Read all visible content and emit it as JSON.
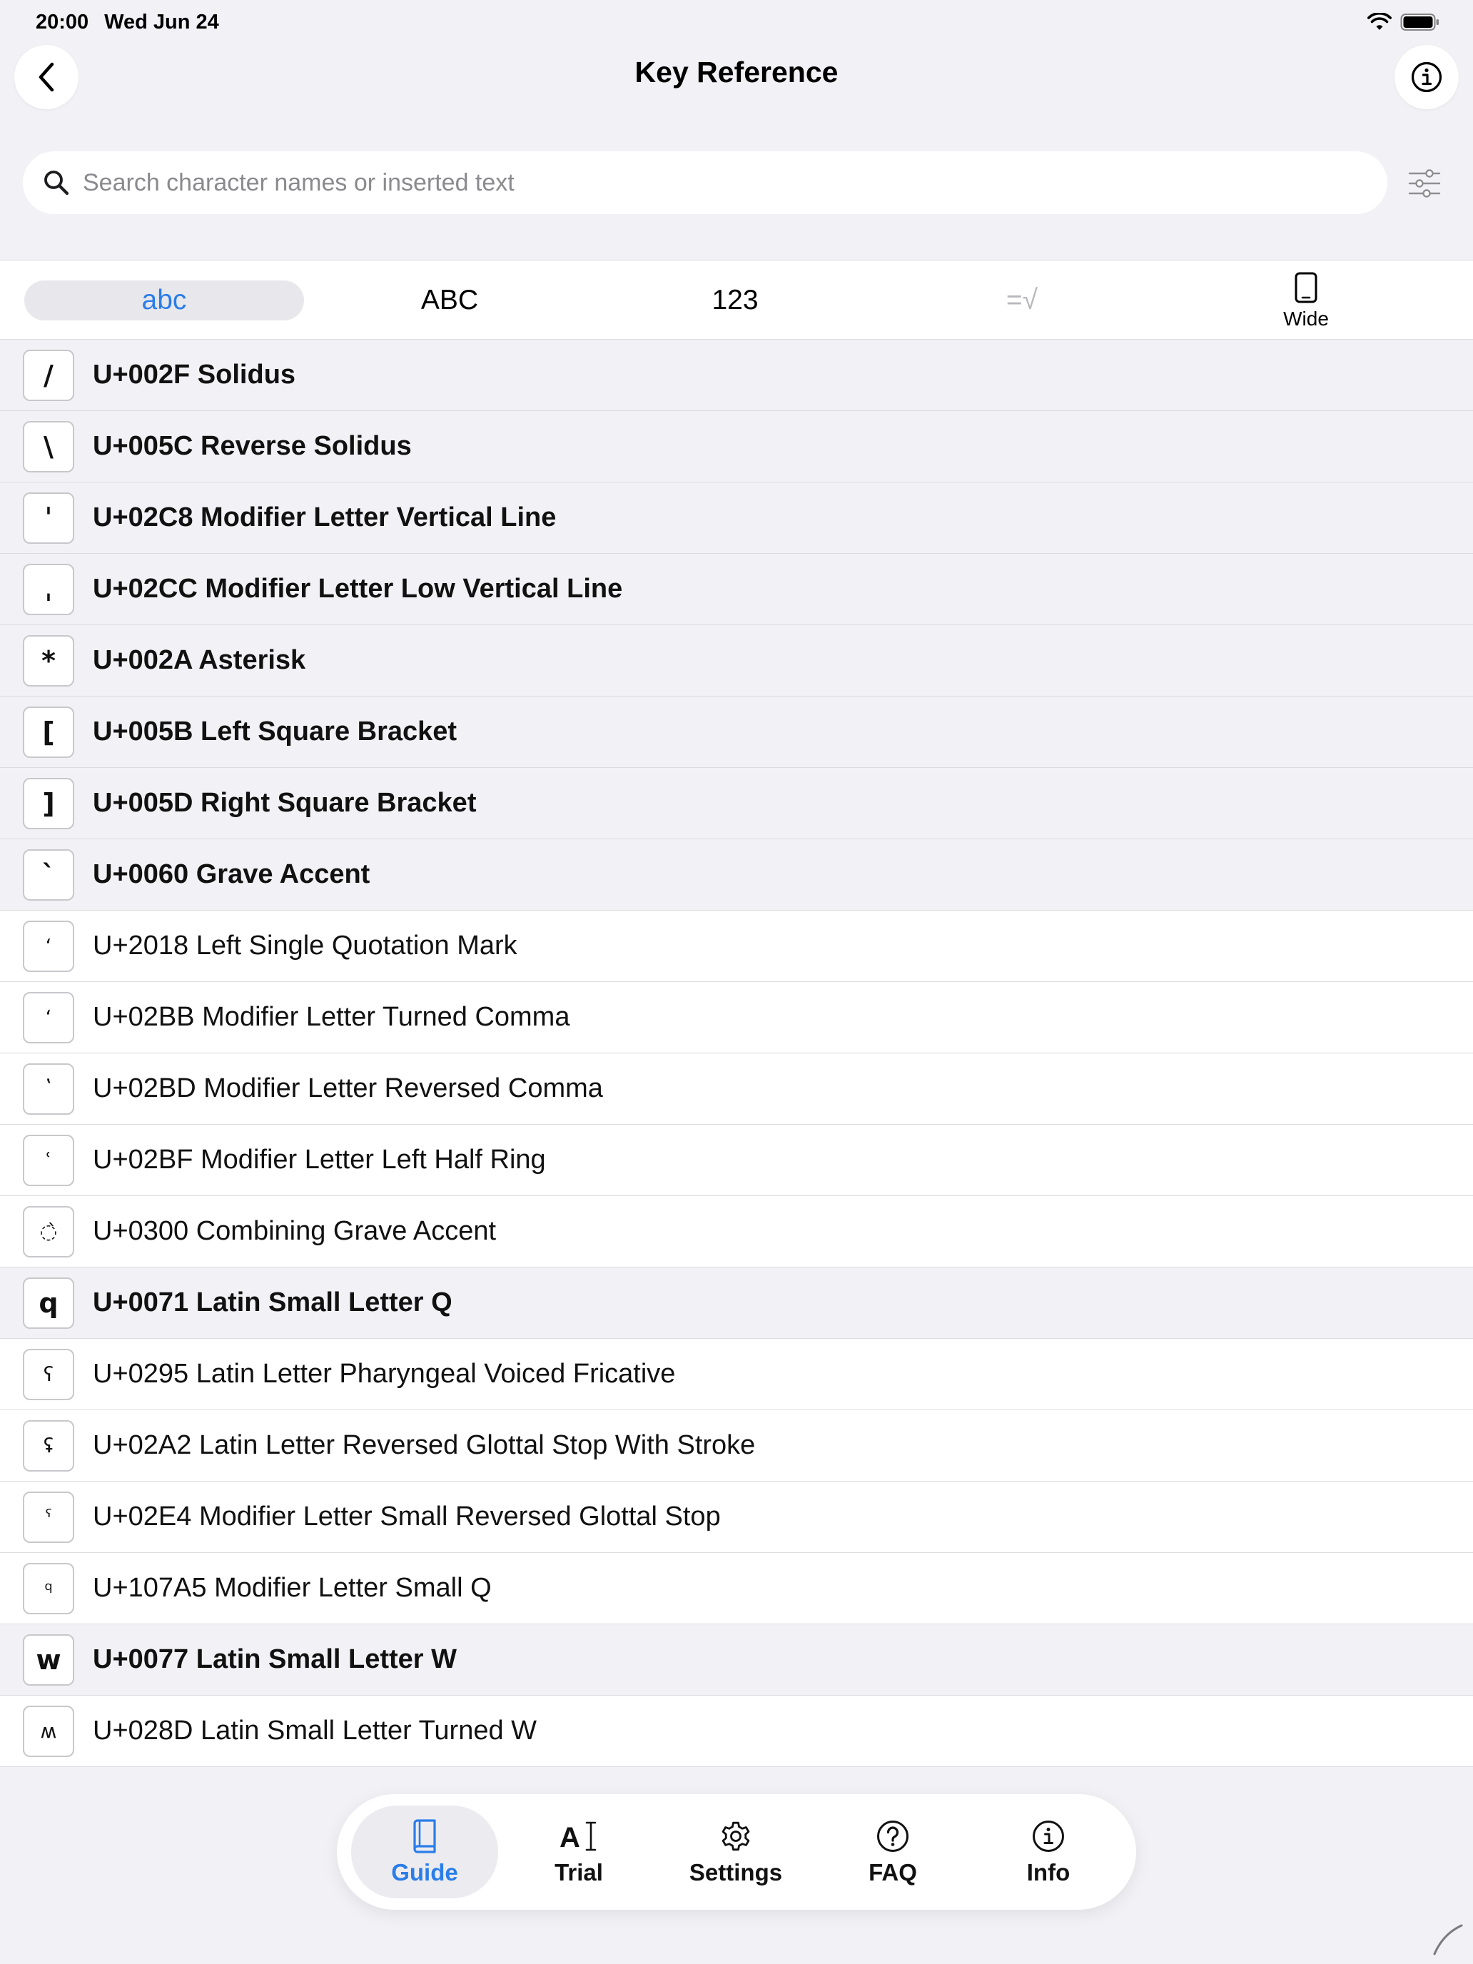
{
  "status_bar": {
    "time": "20:00",
    "date": "Wed Jun 24"
  },
  "header": {
    "title": "Key Reference"
  },
  "search": {
    "placeholder": "Search character names or inserted text"
  },
  "segments": [
    {
      "label": "abc",
      "state": "active"
    },
    {
      "label": "ABC",
      "state": "normal"
    },
    {
      "label": "123",
      "state": "normal"
    },
    {
      "label": "=√",
      "state": "disabled"
    },
    {
      "label": "Wide",
      "icon": "tablet-icon"
    }
  ],
  "rows": [
    {
      "glyph": "/",
      "label": "U+002F Solidus",
      "bold": true
    },
    {
      "glyph": "\\",
      "label": "U+005C Reverse Solidus",
      "bold": true
    },
    {
      "glyph": "ˈ",
      "label": "U+02C8 Modifier Letter Vertical Line",
      "bold": true
    },
    {
      "glyph": "ˌ",
      "label": "U+02CC Modifier Letter Low Vertical Line",
      "bold": true
    },
    {
      "glyph": "*",
      "label": "U+002A Asterisk",
      "bold": true
    },
    {
      "glyph": "[",
      "label": "U+005B Left Square Bracket",
      "bold": true
    },
    {
      "glyph": "]",
      "label": "U+005D Right Square Bracket",
      "bold": true
    },
    {
      "glyph": "`",
      "label": "U+0060 Grave Accent",
      "bold": true
    },
    {
      "glyph": "‘",
      "label": "U+2018 Left Single Quotation Mark",
      "bold": false
    },
    {
      "glyph": "ʻ",
      "label": "U+02BB Modifier Letter Turned Comma",
      "bold": false
    },
    {
      "glyph": "ʽ",
      "label": "U+02BD Modifier Letter Reversed Comma",
      "bold": false
    },
    {
      "glyph": "ʿ",
      "label": "U+02BF Modifier Letter Left Half Ring",
      "bold": false
    },
    {
      "glyph": "◌̀",
      "label": "U+0300 Combining Grave Accent",
      "bold": false
    },
    {
      "glyph": "q",
      "label": "U+0071 Latin Small Letter Q",
      "bold": true
    },
    {
      "glyph": "ʕ",
      "label": "U+0295 Latin Letter Pharyngeal Voiced Fricative",
      "bold": false
    },
    {
      "glyph": "ʢ",
      "label": "U+02A2 Latin Letter Reversed Glottal Stop With Stroke",
      "bold": false
    },
    {
      "glyph": "ˤ",
      "label": "U+02E4 Modifier Letter Small Reversed Glottal Stop",
      "bold": false
    },
    {
      "glyph": "𐞥",
      "label": "U+107A5 Modifier Letter Small Q",
      "bold": false
    },
    {
      "glyph": "w",
      "label": "U+0077 Latin Small Letter W",
      "bold": true
    },
    {
      "glyph": "ʍ",
      "label": "U+028D Latin Small Letter Turned W",
      "bold": false
    }
  ],
  "tabbar": {
    "tabs": [
      {
        "label": "Guide",
        "icon": "book-icon",
        "active": true
      },
      {
        "label": "Trial",
        "icon": "text-cursor-icon",
        "active": false
      },
      {
        "label": "Settings",
        "icon": "gear-icon",
        "active": false
      },
      {
        "label": "FAQ",
        "icon": "question-circle-icon",
        "active": false
      },
      {
        "label": "Info",
        "icon": "info-circle-icon",
        "active": false
      }
    ]
  },
  "colors": {
    "accent": "#2b7de9",
    "background": "#f2f2f6",
    "row_bold_bg": "#f2f2f6",
    "row_bg": "#ffffff"
  }
}
